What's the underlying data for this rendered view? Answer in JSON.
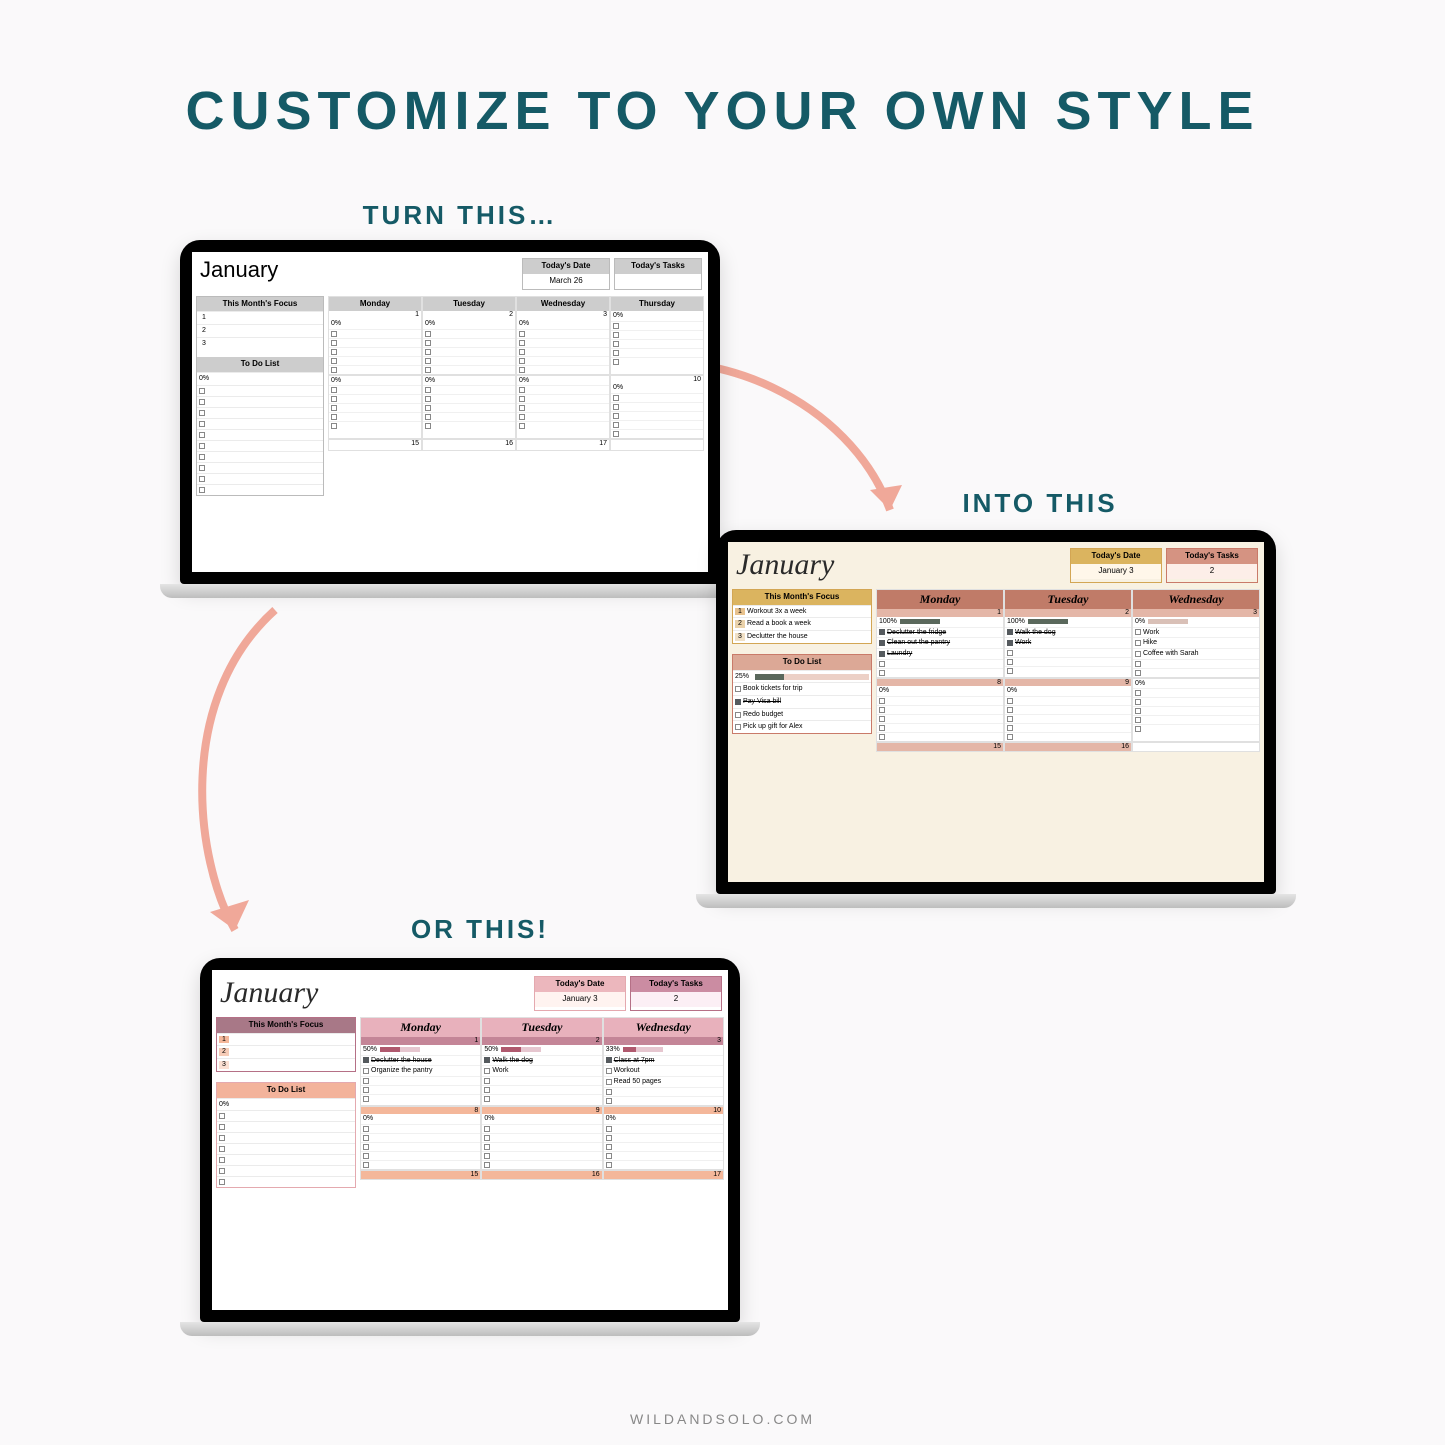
{
  "title": "CUSTOMIZE TO YOUR OWN STYLE",
  "labels": {
    "turn_this": "TURN THIS…",
    "into_this": "INTO THIS",
    "or_this": "OR THIS!"
  },
  "footer": "WILDANDSOLO.COM",
  "shared": {
    "todays_date_label": "Today's Date",
    "todays_tasks_label": "Today's Tasks",
    "focus_label": "This Month's Focus",
    "todo_label": "To Do List"
  },
  "laptop1": {
    "month": "January",
    "todays_date": "March 26",
    "todays_tasks": "",
    "focus": [
      "",
      "",
      ""
    ],
    "todo_pct": "0%",
    "days": [
      "Monday",
      "Tuesday",
      "Wednesday",
      "Thursday"
    ],
    "week1_dates": [
      "1",
      "2",
      "3",
      ""
    ],
    "week1_pct": "0%",
    "week2_dates": [
      "",
      "",
      "",
      "10"
    ],
    "week2_pct": "0%",
    "week3_dates": [
      "15",
      "16",
      "17",
      ""
    ]
  },
  "laptop2": {
    "month": "January",
    "todays_date": "January 3",
    "todays_tasks": "2",
    "focus": [
      "Workout 3x a week",
      "Read a book a week",
      "Declutter the house"
    ],
    "todo_pct": "25%",
    "todo_items": [
      {
        "done": false,
        "label": "Book tickets for trip"
      },
      {
        "done": true,
        "label": "Pay Visa bill"
      },
      {
        "done": false,
        "label": "Redo budget"
      },
      {
        "done": false,
        "label": "Pick up gift for Alex"
      }
    ],
    "days": [
      "Monday",
      "Tuesday",
      "Wednesday"
    ],
    "week1": {
      "dates": [
        "1",
        "2",
        "3"
      ],
      "cols": [
        {
          "pct": "100%",
          "items": [
            {
              "done": true,
              "label": "Declutter the fridge"
            },
            {
              "done": true,
              "label": "Clean out the pantry"
            },
            {
              "done": true,
              "label": "Laundry"
            }
          ]
        },
        {
          "pct": "100%",
          "items": [
            {
              "done": true,
              "label": "Walk the dog"
            },
            {
              "done": true,
              "label": "Work"
            }
          ]
        },
        {
          "pct": "0%",
          "items": [
            {
              "done": false,
              "label": "Work"
            },
            {
              "done": false,
              "label": "Hike"
            },
            {
              "done": false,
              "label": "Coffee with Sarah"
            }
          ]
        }
      ]
    },
    "week2_dates": [
      "8",
      "9",
      ""
    ],
    "week2_pct": "0%",
    "week3_dates": [
      "15",
      "16",
      ""
    ]
  },
  "laptop3": {
    "month": "January",
    "todays_date": "January 3",
    "todays_tasks": "2",
    "focus": [
      "",
      "",
      ""
    ],
    "todo_pct": "0%",
    "days": [
      "Monday",
      "Tuesday",
      "Wednesday"
    ],
    "week1": {
      "dates": [
        "1",
        "2",
        "3"
      ],
      "cols": [
        {
          "pct": "50%",
          "items": [
            {
              "done": true,
              "label": "Declutter the house"
            },
            {
              "done": false,
              "label": "Organize the pantry"
            }
          ]
        },
        {
          "pct": "50%",
          "items": [
            {
              "done": true,
              "label": "Walk the dog"
            },
            {
              "done": false,
              "label": "Work"
            }
          ]
        },
        {
          "pct": "33%",
          "items": [
            {
              "done": true,
              "label": "Class at 7pm"
            },
            {
              "done": false,
              "label": "Workout"
            },
            {
              "done": false,
              "label": "Read 50 pages"
            }
          ]
        }
      ]
    },
    "week2_dates": [
      "8",
      "9",
      "10"
    ],
    "week2_pct": "0%",
    "week3_dates": [
      "15",
      "16",
      "17"
    ]
  }
}
